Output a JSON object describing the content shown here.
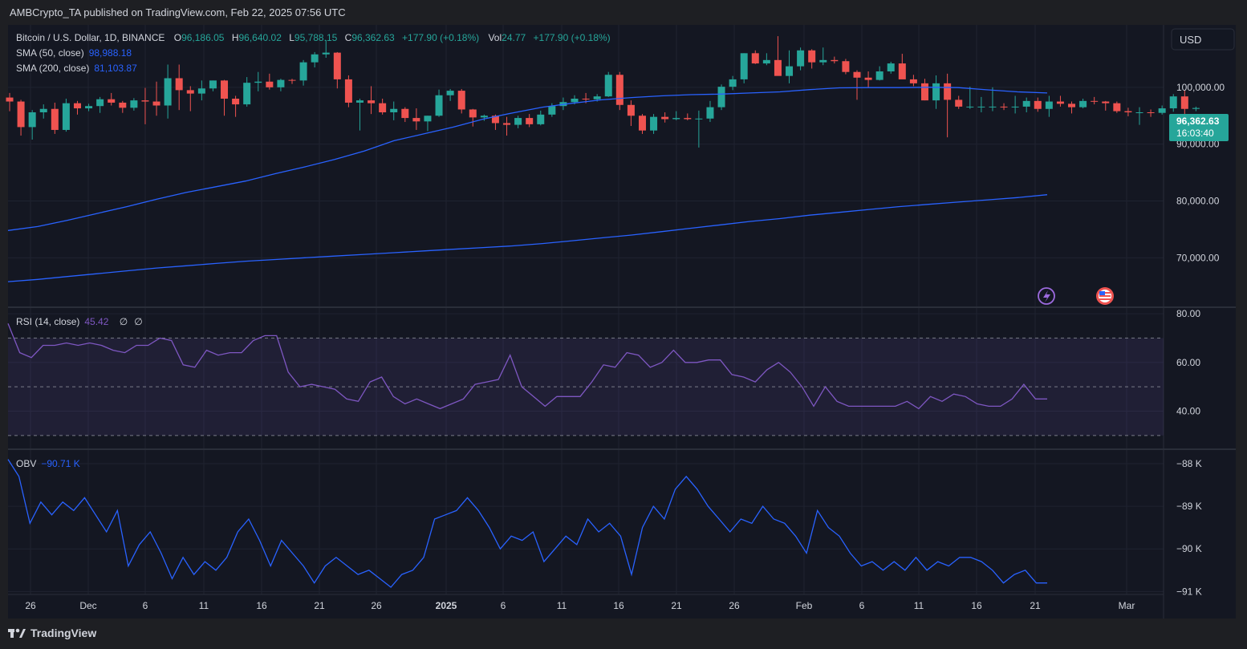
{
  "header": {
    "publisher": "AMBCrypto_TA published on TradingView.com, Feb 22, 2025 07:56 UTC"
  },
  "legend": {
    "symbol": "Bitcoin / U.S. Dollar, 1D, BINANCE",
    "o_label": "O",
    "o_value": "96,186.05",
    "h_label": "H",
    "h_value": "96,640.02",
    "l_label": "L",
    "l_value": "95,788.15",
    "c_label": "C",
    "c_value": "96,362.63",
    "change": "+177.90 (+0.18%)",
    "vol_label": "Vol",
    "vol_value": "24.77",
    "vol_change": "+177.90 (+0.18%)",
    "sma50_label": "SMA (50, close)",
    "sma50_value": "98,988.18",
    "sma200_label": "SMA (200, close)",
    "sma200_value": "81,103.87"
  },
  "currency_button": "USD",
  "price_tag": {
    "price": "96,362.63",
    "countdown": "16:03:40"
  },
  "rsi_legend": {
    "label": "RSI (14, close)",
    "value": "45.42",
    "extra1": "∅",
    "extra2": "∅"
  },
  "obv_legend": {
    "label": "OBV",
    "value": "−90.71 K"
  },
  "footer": {
    "brand": "TradingView"
  },
  "colors": {
    "up": "#26a69a",
    "down": "#ef5350",
    "sma": "#2962ff",
    "rsi": "#7e57c2",
    "obv": "#2962ff",
    "bg": "#141722"
  },
  "chart_data": [
    {
      "type": "candlestick",
      "title": "Bitcoin / U.S. Dollar, 1D, BINANCE",
      "x_ticks": [
        "26",
        "Dec",
        "6",
        "11",
        "16",
        "21",
        "26",
        "2025",
        "6",
        "11",
        "16",
        "21",
        "26",
        "Feb",
        "6",
        "11",
        "16",
        "21",
        "Mar"
      ],
      "y_ticks": [
        "100,000.00",
        "90,000.00",
        "80,000.00",
        "70,000.00"
      ],
      "ylim": [
        62000,
        110000
      ],
      "candles": [
        [
          98200,
          99000,
          95800,
          97500
        ],
        [
          97500,
          97800,
          91500,
          93000
        ],
        [
          93000,
          96000,
          90800,
          95600
        ],
        [
          95600,
          97000,
          94500,
          96200
        ],
        [
          96200,
          97300,
          91800,
          92500
        ],
        [
          92500,
          98000,
          92200,
          97200
        ],
        [
          97200,
          97600,
          95200,
          96300
        ],
        [
          96300,
          97100,
          95800,
          96700
        ],
        [
          96700,
          98300,
          95500,
          97900
        ],
        [
          97900,
          99000,
          96800,
          97300
        ],
        [
          97300,
          97600,
          95500,
          96400
        ],
        [
          96400,
          98100,
          95900,
          97700
        ],
        [
          97700,
          99900,
          93500,
          97500
        ],
        [
          97500,
          101000,
          95000,
          96800
        ],
        [
          96800,
          104000,
          94500,
          101600
        ],
        [
          101600,
          104000,
          96000,
          99500
        ],
        [
          99500,
          100200,
          95800,
          98900
        ],
        [
          98900,
          101200,
          97700,
          99800
        ],
        [
          99800,
          101200,
          99300,
          101200
        ],
        [
          101200,
          101300,
          95000,
          98000
        ],
        [
          98000,
          98500,
          94800,
          97000
        ],
        [
          97000,
          101800,
          96600,
          100800
        ],
        [
          100800,
          102700,
          99300,
          101000
        ],
        [
          101000,
          102400,
          99600,
          100000
        ],
        [
          100000,
          101500,
          99300,
          101300
        ],
        [
          101300,
          101500,
          100600,
          101200
        ],
        [
          101200,
          104800,
          100300,
          104400
        ],
        [
          104400,
          106200,
          103500,
          105800
        ],
        [
          105800,
          108300,
          105200,
          106100
        ],
        [
          106100,
          106200,
          99800,
          101400
        ],
        [
          101400,
          102100,
          96500,
          97300
        ],
        [
          97300,
          98000,
          92400,
          97700
        ],
        [
          97700,
          100200,
          95300,
          97200
        ],
        [
          97200,
          98000,
          95200,
          95600
        ],
        [
          95600,
          97500,
          94200,
          96200
        ],
        [
          96200,
          96500,
          93900,
          94600
        ],
        [
          94600,
          96300,
          92500,
          94000
        ],
        [
          94000,
          95000,
          92300,
          95000
        ],
        [
          95000,
          99600,
          94800,
          98600
        ],
        [
          98600,
          99700,
          97600,
          99400
        ],
        [
          99400,
          99700,
          95400,
          96100
        ],
        [
          96100,
          96200,
          93100,
          94700
        ],
        [
          94700,
          95200,
          94100,
          95000
        ],
        [
          95000,
          95200,
          92500,
          93700
        ],
        [
          93700,
          94800,
          91500,
          93400
        ],
        [
          93400,
          95000,
          92800,
          94600
        ],
        [
          94600,
          95300,
          93000,
          93500
        ],
        [
          93500,
          95900,
          93300,
          95200
        ],
        [
          95200,
          97200,
          94800,
          96700
        ],
        [
          96700,
          98200,
          96000,
          97400
        ],
        [
          97400,
          98600,
          97000,
          98000
        ],
        [
          98000,
          99000,
          97200,
          97900
        ],
        [
          97900,
          98800,
          97500,
          98400
        ],
        [
          98400,
          102700,
          98300,
          102200
        ],
        [
          102200,
          102700,
          96000,
          96900
        ],
        [
          96900,
          97700,
          93200,
          95000
        ],
        [
          95000,
          95300,
          91800,
          92400
        ],
        [
          92400,
          95300,
          91800,
          94800
        ],
        [
          94800,
          95600,
          93800,
          94400
        ],
        [
          94400,
          95800,
          94200,
          94600
        ],
        [
          94600,
          95400,
          94200,
          94400
        ],
        [
          94400,
          95900,
          89400,
          94500
        ],
        [
          94500,
          97600,
          93900,
          96500
        ],
        [
          96500,
          100500,
          96000,
          100100
        ],
        [
          100100,
          102000,
          99500,
          101400
        ],
        [
          101400,
          106000,
          100700,
          106000
        ],
        [
          106000,
          106500,
          104100,
          104200
        ],
        [
          104200,
          106000,
          103900,
          104800
        ],
        [
          104800,
          109000,
          102100,
          102000
        ],
        [
          102000,
          106500,
          100700,
          103700
        ],
        [
          103700,
          107000,
          103000,
          106500
        ],
        [
          106500,
          106700,
          103300,
          104400
        ],
        [
          104400,
          107000,
          103900,
          104800
        ],
        [
          104800,
          105400,
          104200,
          104600
        ],
        [
          104600,
          105000,
          102300,
          102700
        ],
        [
          102700,
          103000,
          97800,
          101700
        ],
        [
          101700,
          102800,
          100000,
          101300
        ],
        [
          101300,
          103700,
          101200,
          102800
        ],
        [
          102800,
          104500,
          102400,
          104200
        ],
        [
          104200,
          105900,
          102400,
          101400
        ],
        [
          101400,
          102200,
          100200,
          100700
        ],
        [
          100700,
          101500,
          97700,
          97700
        ],
        [
          97700,
          102100,
          96200,
          100700
        ],
        [
          100700,
          102400,
          91200,
          97800
        ],
        [
          97800,
          98500,
          96200,
          96600
        ],
        [
          96600,
          100100,
          96200,
          96600
        ],
        [
          96600,
          98300,
          95600,
          96600
        ],
        [
          96600,
          100000,
          95800,
          96600
        ],
        [
          96600,
          97200,
          96000,
          96500
        ],
        [
          96500,
          98500,
          95400,
          96600
        ],
        [
          96600,
          98200,
          95600,
          97600
        ],
        [
          97600,
          98200,
          95700,
          96200
        ],
        [
          96200,
          98500,
          94800,
          97500
        ],
        [
          97500,
          98500,
          96600,
          97100
        ],
        [
          97100,
          97500,
          95400,
          96500
        ],
        [
          96500,
          98000,
          96300,
          97600
        ],
        [
          97600,
          98300,
          97000,
          97500
        ],
        [
          97500,
          97600,
          95900,
          97200
        ],
        [
          97200,
          97500,
          95500,
          95800
        ],
        [
          95800,
          96400,
          94900,
          95600
        ],
        [
          95600,
          96500,
          93400,
          95600
        ],
        [
          95600,
          96100,
          94800,
          95500
        ],
        [
          95500,
          96800,
          95200,
          96300
        ],
        [
          96300,
          98800,
          95700,
          98400
        ],
        [
          98400,
          99500,
          95000,
          96200
        ],
        [
          96200,
          96600,
          95800,
          96360
        ]
      ],
      "sma50": [
        74800,
        75500,
        76600,
        77800,
        79000,
        80300,
        81500,
        82500,
        83500,
        84800,
        86000,
        87300,
        88800,
        90600,
        91800,
        93000,
        94400,
        95500,
        96500,
        97200,
        97800,
        98200,
        98500,
        98700,
        98800,
        99000,
        99200,
        99600,
        99900,
        99950,
        99950,
        100000,
        99950,
        99550,
        99200,
        99000
      ],
      "sma200": [
        65800,
        66200,
        66700,
        67200,
        67700,
        68200,
        68600,
        69000,
        69400,
        69700,
        70000,
        70300,
        70600,
        70900,
        71200,
        71500,
        71800,
        72100,
        72500,
        73000,
        73500,
        74000,
        74600,
        75200,
        75800,
        76400,
        76900,
        77500,
        78000,
        78500,
        79000,
        79400,
        79800,
        80200,
        80600,
        81100
      ]
    },
    {
      "type": "line",
      "title": "RSI (14, close)",
      "y_ticks": [
        "80.00",
        "60.00",
        "40.00"
      ],
      "ylim": [
        25,
        82
      ],
      "bands": [
        30,
        50,
        70
      ],
      "values": [
        76,
        64,
        62,
        67,
        67,
        68,
        67,
        68,
        67,
        65,
        64,
        67,
        67,
        70,
        69,
        59,
        58,
        65,
        63,
        64,
        64,
        69,
        71,
        71,
        56,
        50,
        51,
        50,
        49,
        45,
        44,
        52,
        54,
        46,
        43,
        45,
        43,
        41,
        43,
        45,
        51,
        52,
        53,
        63,
        50,
        46,
        42,
        46,
        46,
        46,
        52,
        59,
        58,
        64,
        63,
        58,
        60,
        65,
        60,
        60,
        61,
        61,
        55,
        54,
        52,
        57,
        60,
        56,
        50,
        42,
        50,
        44,
        42,
        42,
        42,
        42,
        42,
        44,
        41,
        46,
        44,
        47,
        46,
        43,
        42,
        42,
        45,
        51,
        45,
        45
      ]
    },
    {
      "type": "line",
      "title": "OBV",
      "y_ticks": [
        "−88 K",
        "−89 K",
        "−90 K",
        "−91 K"
      ],
      "ylim": [
        -91.05,
        -87.7
      ],
      "values": [
        -87.9,
        -88.3,
        -89.4,
        -88.9,
        -89.2,
        -88.9,
        -89.1,
        -88.8,
        -89.2,
        -89.6,
        -89.1,
        -90.4,
        -89.9,
        -89.6,
        -90.1,
        -90.7,
        -90.2,
        -90.6,
        -90.3,
        -90.5,
        -90.2,
        -89.6,
        -89.3,
        -89.8,
        -90.4,
        -89.8,
        -90.1,
        -90.4,
        -90.8,
        -90.4,
        -90.2,
        -90.4,
        -90.6,
        -90.5,
        -90.7,
        -90.9,
        -90.6,
        -90.5,
        -90.2,
        -89.3,
        -89.2,
        -89.1,
        -88.8,
        -89.1,
        -89.5,
        -90.0,
        -89.7,
        -89.8,
        -89.6,
        -90.3,
        -90.0,
        -89.7,
        -89.9,
        -89.3,
        -89.6,
        -89.4,
        -89.7,
        -90.6,
        -89.5,
        -89.0,
        -89.3,
        -88.6,
        -88.3,
        -88.6,
        -89.0,
        -89.3,
        -89.6,
        -89.3,
        -89.4,
        -89.0,
        -89.3,
        -89.4,
        -89.7,
        -90.1,
        -89.1,
        -89.5,
        -89.7,
        -90.1,
        -90.4,
        -90.3,
        -90.5,
        -90.3,
        -90.5,
        -90.2,
        -90.5,
        -90.3,
        -90.4,
        -90.2,
        -90.2,
        -90.3,
        -90.5,
        -90.8,
        -90.6,
        -90.5,
        -90.8,
        -90.8
      ]
    }
  ]
}
